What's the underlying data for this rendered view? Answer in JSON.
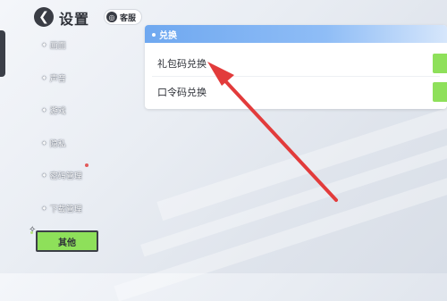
{
  "header": {
    "title": "设置",
    "customer_service_label": "客服"
  },
  "sidebar": {
    "items": [
      {
        "label": "画面"
      },
      {
        "label": "声音"
      },
      {
        "label": "游戏"
      },
      {
        "label": "隐私"
      },
      {
        "label": "密码管理"
      },
      {
        "label": "下载管理"
      }
    ],
    "active": {
      "label": "其他"
    }
  },
  "main": {
    "section_title": "兑换",
    "rows": [
      {
        "label": "礼包码兑换"
      },
      {
        "label": "口令码兑换"
      }
    ]
  },
  "colors": {
    "accent_green": "#8ee05a",
    "header_blue": "#6fa8f0",
    "annotation_red": "#e23b3b"
  }
}
